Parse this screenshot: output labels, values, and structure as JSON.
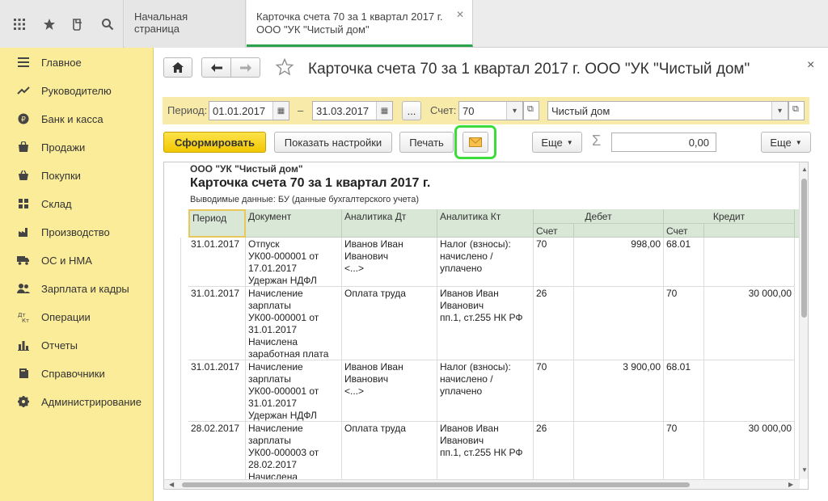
{
  "tabs": {
    "home": "Начальная страница",
    "active_line1": "Карточка счета 70 за 1 квартал 2017 г.",
    "active_line2": "ООО \"УК \"Чистый дом\""
  },
  "sidebar": {
    "items": [
      {
        "label": "Главное",
        "icon": "menu-icon"
      },
      {
        "label": "Руководителю",
        "icon": "chart-up-icon"
      },
      {
        "label": "Банк и касса",
        "icon": "ruble-icon"
      },
      {
        "label": "Продажи",
        "icon": "cart-icon"
      },
      {
        "label": "Покупки",
        "icon": "basket-icon"
      },
      {
        "label": "Склад",
        "icon": "warehouse-icon"
      },
      {
        "label": "Производство",
        "icon": "factory-icon"
      },
      {
        "label": "ОС и НМА",
        "icon": "truck-icon"
      },
      {
        "label": "Зарплата и кадры",
        "icon": "people-icon"
      },
      {
        "label": "Операции",
        "icon": "dt-kt-icon"
      },
      {
        "label": "Отчеты",
        "icon": "bar-chart-icon"
      },
      {
        "label": "Справочники",
        "icon": "book-icon"
      },
      {
        "label": "Администрирование",
        "icon": "gear-icon"
      }
    ]
  },
  "form": {
    "title": "Карточка счета 70 за 1 квартал 2017 г. ООО \"УК \"Чистый дом\"",
    "close": "×",
    "period_label": "Период:",
    "period_from": "01.01.2017",
    "period_dash": "–",
    "period_to": "31.03.2017",
    "ellipsis": "...",
    "account_label": "Счет:",
    "account_value": "70",
    "org_value": "Чистый дом",
    "generate_btn": "Сформировать",
    "settings_btn": "Показать настройки",
    "print_btn": "Печать",
    "more_btn1": "Еще",
    "sum_value": "0,00",
    "more_btn2": "Еще",
    "sigma": "Σ"
  },
  "report": {
    "org": "ООО \"УК \"Чистый дом\"",
    "title": "Карточка счета 70 за 1 квартал 2017 г.",
    "subtitle": "Выводимые данные:  БУ (данные бухгалтерского учета)",
    "headers": {
      "period": "Период",
      "document": "Документ",
      "analytics_dt": "Аналитика Дт",
      "analytics_kt": "Аналитика Кт",
      "debit": "Дебет",
      "credit": "Кредит",
      "account_dt": "Счет",
      "account_kt": "Счет"
    },
    "rows": [
      {
        "period": "31.01.2017",
        "document": "Отпуск\nУК00-000001 от\n17.01.2017\nУдержан НДФЛ",
        "analytics_dt": "Иванов Иван\nИванович\n<...>",
        "analytics_kt": "Налог (взносы):\nначислено /\nуплачено",
        "debit_account": "70",
        "debit_sum": "998,00",
        "credit_account": "68.01",
        "credit_sum": ""
      },
      {
        "period": "31.01.2017",
        "document": "Начисление\nзарплаты\nУК00-000001 от\n31.01.2017\nНачислена\nзаработная плата",
        "analytics_dt": "Оплата труда",
        "analytics_kt": "Иванов Иван\nИванович\nпп.1, ст.255 НК РФ",
        "debit_account": "26",
        "debit_sum": "",
        "credit_account": "70",
        "credit_sum": "30 000,00"
      },
      {
        "period": "31.01.2017",
        "document": "Начисление\nзарплаты\nУК00-000001 от\n31.01.2017\nУдержан НДФЛ",
        "analytics_dt": "Иванов Иван\nИванович\n<...>",
        "analytics_kt": "Налог (взносы):\nначислено /\nуплачено",
        "debit_account": "70",
        "debit_sum": "3 900,00",
        "credit_account": "68.01",
        "credit_sum": ""
      },
      {
        "period": "28.02.2017",
        "document": "Начисление\nзарплаты\nУК00-000003 от\n28.02.2017\nНачислена",
        "analytics_dt": "Оплата труда",
        "analytics_kt": "Иванов Иван\nИванович\nпп.1, ст.255 НК РФ",
        "debit_account": "26",
        "debit_sum": "",
        "credit_account": "70",
        "credit_sum": "30 000,00"
      }
    ]
  },
  "colors": {
    "sidebar_bg": "#fbec9a",
    "accent_green": "#2aa34a",
    "highlight_green": "#3ddc3d",
    "primary_button": "#f2c700",
    "table_header": "#d9e7d6"
  }
}
